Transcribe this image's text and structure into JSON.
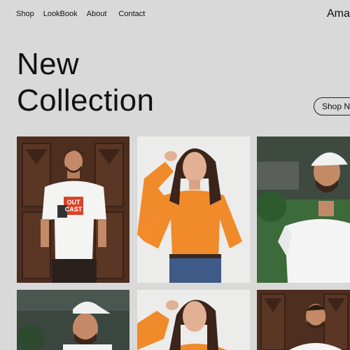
{
  "nav": {
    "items": [
      "Shop",
      "LookBook",
      "About",
      "Contact"
    ]
  },
  "brand": {
    "name": "Ama"
  },
  "hero": {
    "title_line1": "New",
    "title_line2": "Collection",
    "cta": "Shop No"
  },
  "products": [
    {
      "shirt_text_line1": "OUT",
      "shirt_text_line2": "CAST"
    }
  ],
  "colors": {
    "background": "#d9d9d9",
    "accent_orange": "#f08a2a",
    "door_brown": "#4e2e1f"
  }
}
